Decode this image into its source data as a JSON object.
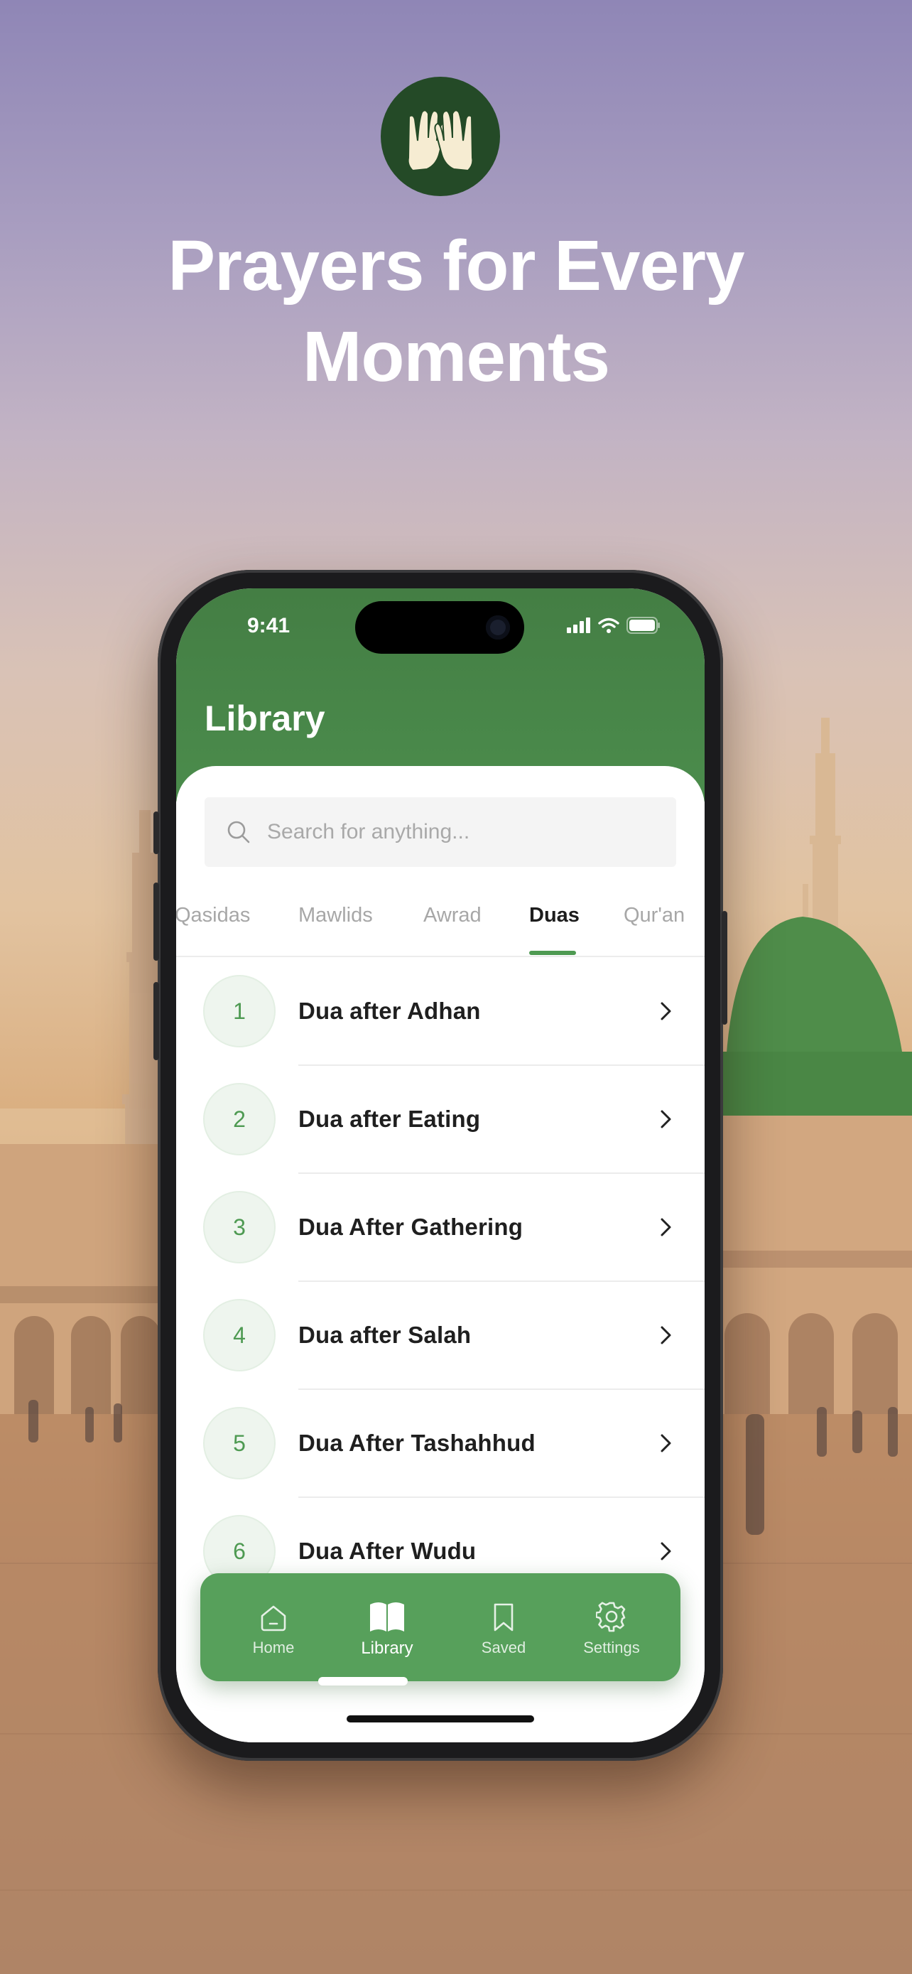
{
  "hero": {
    "title_line1": "Prayers for Every",
    "title_line2": "Moments",
    "logo_icon": "praying-hands-icon"
  },
  "status_bar": {
    "time": "9:41"
  },
  "header": {
    "title": "Library"
  },
  "search": {
    "placeholder": "Search for anything..."
  },
  "tabs": [
    {
      "label": "Qasidas",
      "active": false
    },
    {
      "label": "Mawlids",
      "active": false
    },
    {
      "label": "Awrad",
      "active": false
    },
    {
      "label": "Duas",
      "active": true
    },
    {
      "label": "Qur'an",
      "active": false
    }
  ],
  "list": [
    {
      "number": "1",
      "label": "Dua after Adhan"
    },
    {
      "number": "2",
      "label": "Dua after Eating"
    },
    {
      "number": "3",
      "label": "Dua After Gathering"
    },
    {
      "number": "4",
      "label": "Dua after Salah"
    },
    {
      "number": "5",
      "label": "Dua After Tashahhud"
    },
    {
      "number": "6",
      "label": "Dua After Wudu"
    }
  ],
  "tabbar": [
    {
      "label": "Home",
      "icon": "home-icon",
      "active": false
    },
    {
      "label": "Library",
      "icon": "book-icon",
      "active": true
    },
    {
      "label": "Saved",
      "icon": "bookmark-icon",
      "active": false
    },
    {
      "label": "Settings",
      "icon": "gear-icon",
      "active": false
    }
  ],
  "colors": {
    "brand_green": "#4b8c4c",
    "tabbar_green": "#57a05b",
    "logo_bg": "#244a27",
    "accent_underline": "#4e9a52"
  }
}
